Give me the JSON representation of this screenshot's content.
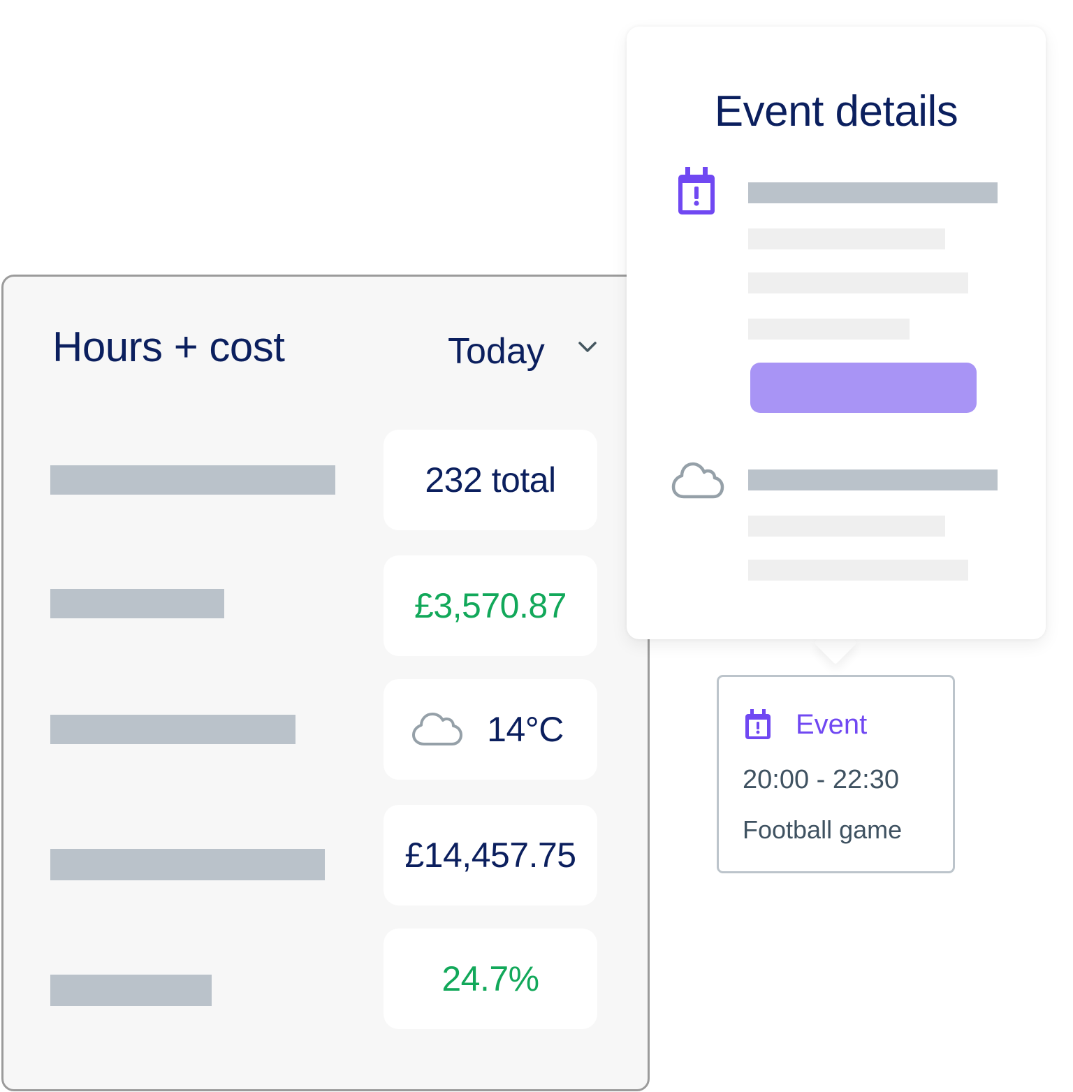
{
  "hours_card": {
    "title": "Hours + cost",
    "period_select": {
      "selected": "Today",
      "icon": "chevron-down-icon"
    },
    "rows": [
      {
        "value": "232 total",
        "value_color": "#0b1f5e"
      },
      {
        "value": "£3,570.87",
        "value_color": "#12a85a"
      },
      {
        "value": "14°C",
        "value_color": "#0b1f5e",
        "icon": "cloud-icon"
      },
      {
        "value": "£14,457.75",
        "value_color": "#0b1f5e"
      },
      {
        "value": "24.7%",
        "value_color": "#12a85a"
      }
    ]
  },
  "event_details_popup": {
    "title": "Event details",
    "sections": [
      {
        "icon": "calendar-alert-icon",
        "icon_color": "#7048f2"
      },
      {
        "icon": "cloud-icon",
        "icon_color": "#95a0a8"
      }
    ],
    "action_button_color": "#a894f5"
  },
  "event_card": {
    "icon": "calendar-alert-icon",
    "type_label": "Event",
    "time": "20:00 - 22:30",
    "name": "Football game",
    "accent": "#7048f2"
  }
}
